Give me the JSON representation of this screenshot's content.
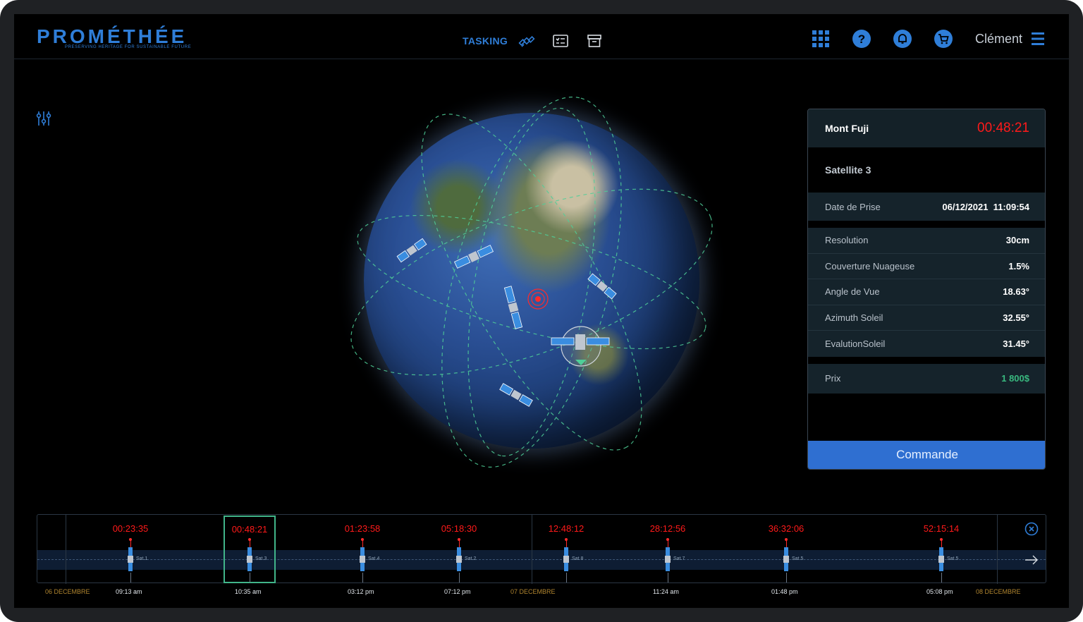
{
  "brand": {
    "name": "PROMÉTHÉE",
    "tagline": "PRESERVING HERITAGE FOR SUSTAINABLE FUTURE",
    "accent_color": "#2f7ed8"
  },
  "nav": {
    "tasking_label": "TASKING",
    "icons": [
      "satellite-icon",
      "checklist-icon",
      "archive-icon"
    ]
  },
  "user": {
    "name": "Clément",
    "icons": [
      "apps-grid-icon",
      "help-icon",
      "bell-icon",
      "cart-icon",
      "menu-icon"
    ]
  },
  "panel": {
    "title": "Mont Fuji",
    "timer": "00:48:21",
    "satellite": "Satellite 3",
    "date_label": "Date de Prise",
    "date_value": "06/12/2021  11:09:54",
    "specs": [
      {
        "label": "Resolution",
        "value": "30cm"
      },
      {
        "label": "Couverture Nuageuse",
        "value": "1.5%"
      },
      {
        "label": "Angle de Vue",
        "value": "18.63°"
      },
      {
        "label": "Azimuth Soleil",
        "value": "32.55°"
      },
      {
        "label": "EvalutionSoleil",
        "value": "31.45°"
      }
    ],
    "price_label": "Prix",
    "price_value": "1 800$",
    "order_label": "Commande",
    "timer_color": "#ff1a1a",
    "price_color": "#39b97f"
  },
  "timeline": {
    "items": [
      {
        "timer": "00:23:35",
        "sat": "Sat.1",
        "time": "09:13 am"
      },
      {
        "timer": "00:48:21",
        "sat": "Sat.3",
        "time": "10:35 am",
        "selected": true
      },
      {
        "timer": "01:23:58",
        "sat": "Sat.4",
        "time": "03:12 pm"
      },
      {
        "timer": "05:18:30",
        "sat": "Sat.2",
        "time": "07:12 pm"
      },
      {
        "timer": "12:48:12",
        "sat": "Sat.8",
        "time": ""
      },
      {
        "timer": "28:12:56",
        "sat": "Sat.7",
        "time": "11:24 am"
      },
      {
        "timer": "36:32:06",
        "sat": "Sat.5",
        "time": "01:48 pm"
      },
      {
        "timer": "52:15:14",
        "sat": "Sat.5",
        "time": "05:08 pm"
      }
    ],
    "dates": [
      "06 DECEMBRE",
      "07 DECEMBRE",
      "08 DECEMBRE"
    ],
    "date_color": "#b0852f",
    "selection_color": "#41b58a"
  }
}
